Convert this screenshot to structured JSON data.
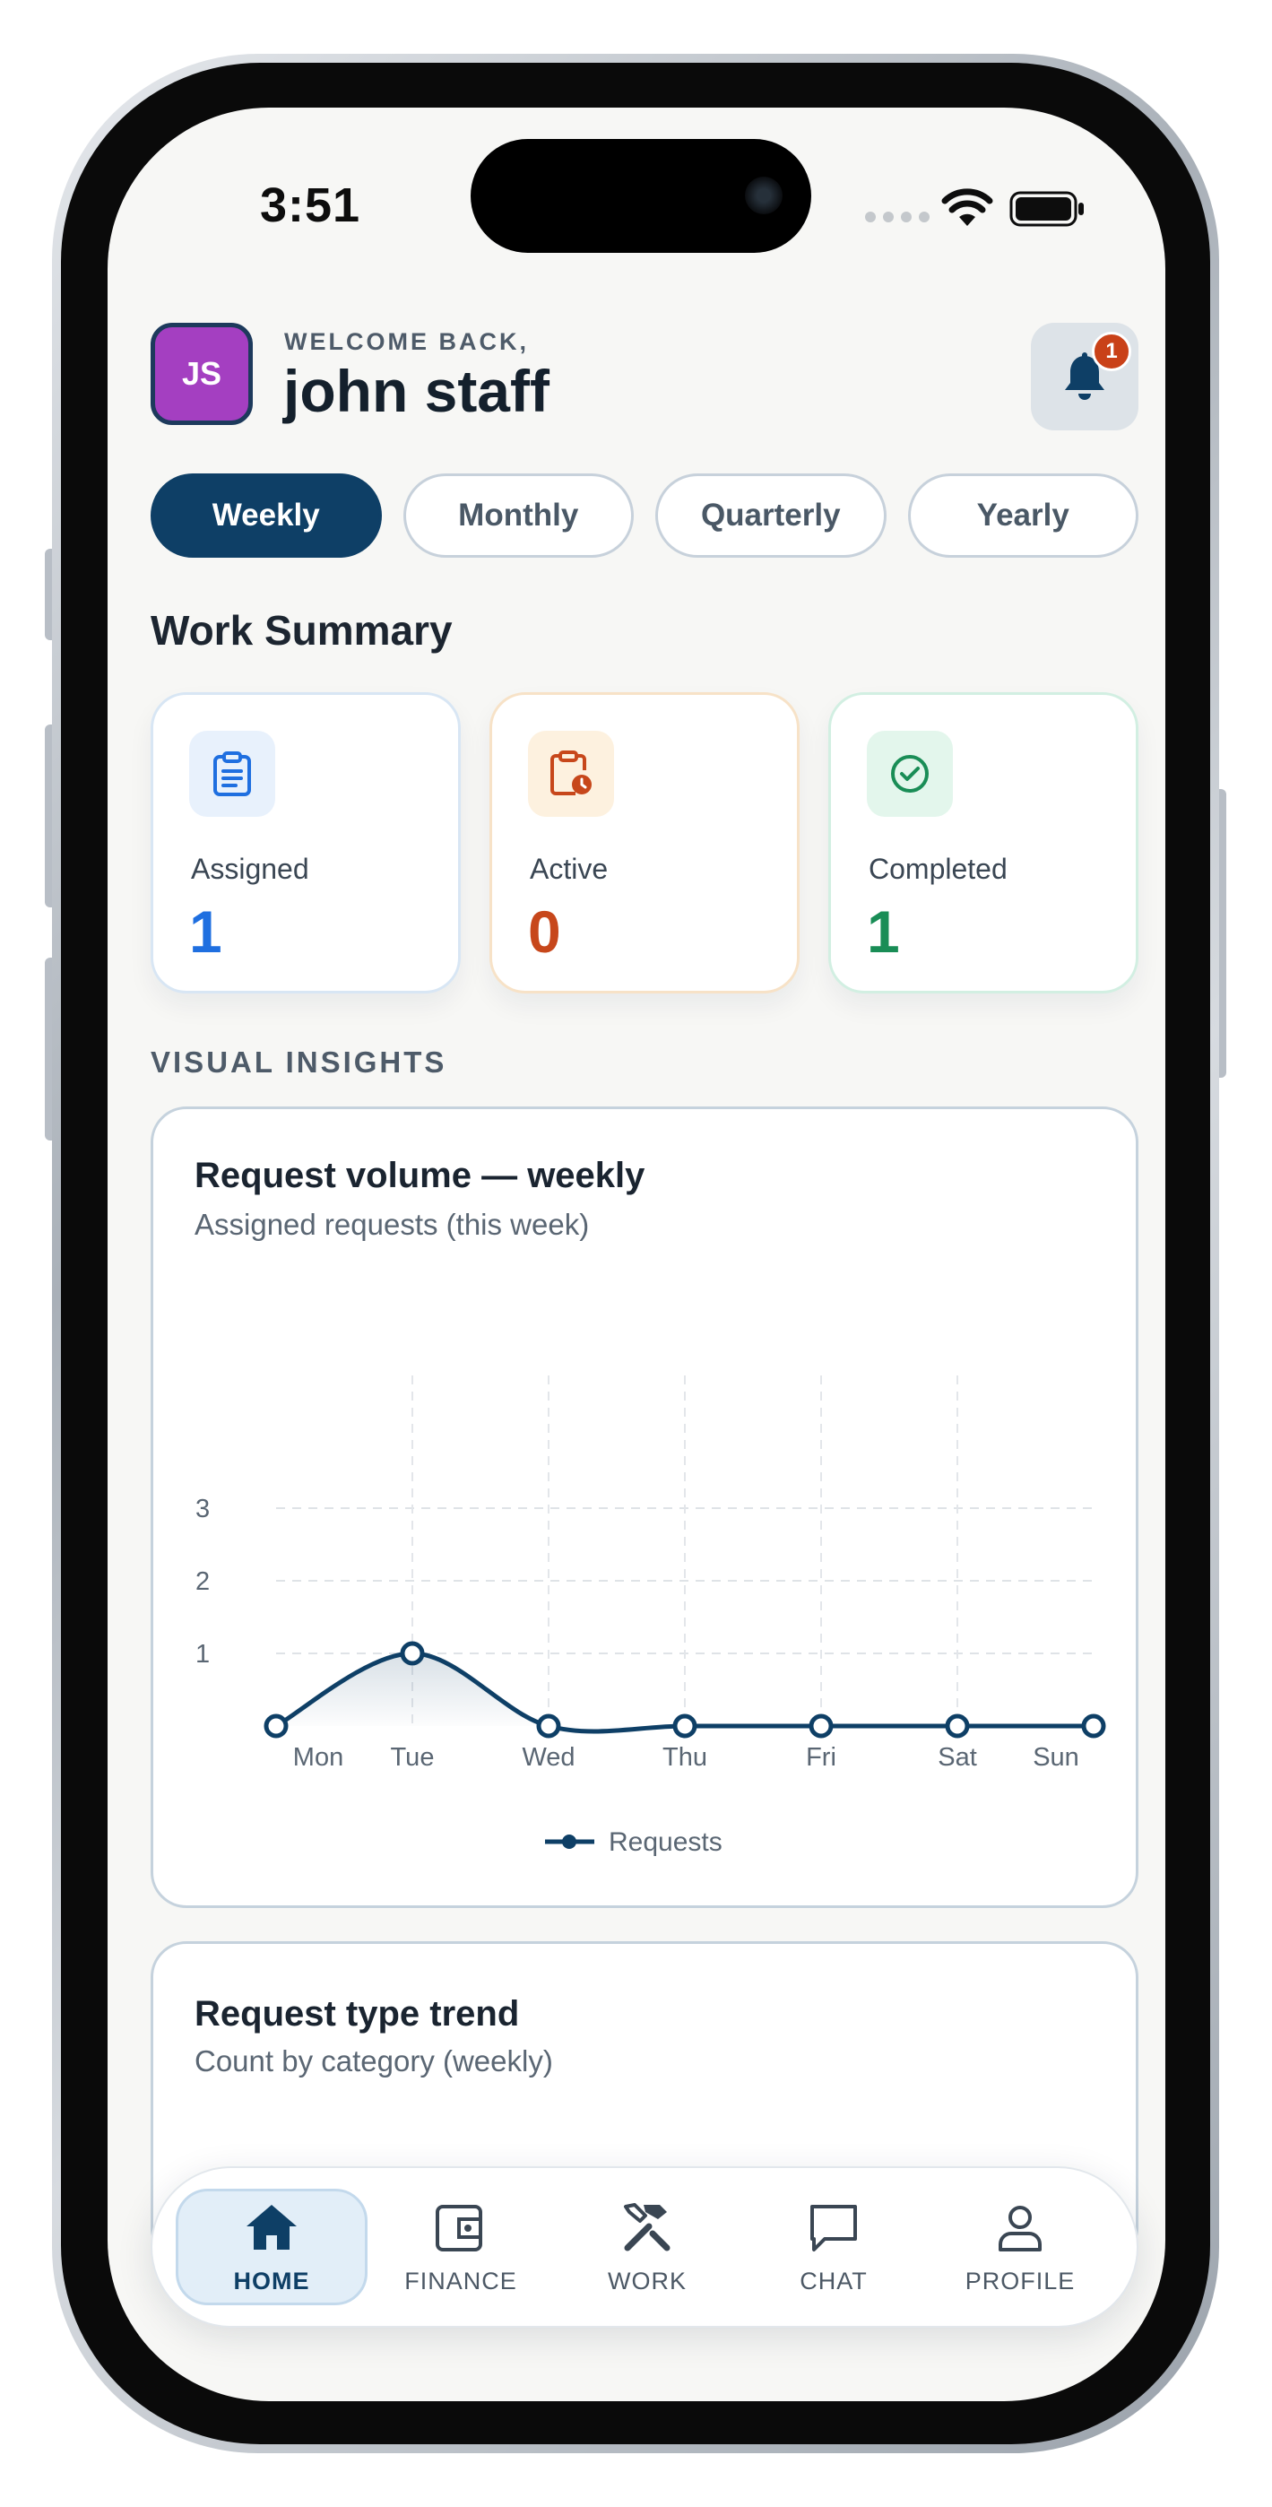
{
  "status_bar": {
    "time": "3:51"
  },
  "header": {
    "avatar_initials": "JS",
    "welcome": "WELCOME BACK,",
    "username": "john staff",
    "notification_count": "1"
  },
  "period_tabs": [
    {
      "label": "Weekly",
      "selected": true
    },
    {
      "label": "Monthly",
      "selected": false
    },
    {
      "label": "Quarterly",
      "selected": false
    },
    {
      "label": "Yearly",
      "selected": false
    }
  ],
  "work_summary": {
    "title": "Work Summary",
    "cards": [
      {
        "label": "Assigned",
        "value": "1",
        "icon": "clipboard-list-icon",
        "color": "#1f6fe0"
      },
      {
        "label": "Active",
        "value": "0",
        "icon": "clipboard-clock-icon",
        "color": "#c7471b"
      },
      {
        "label": "Completed",
        "value": "1",
        "icon": "check-circle-icon",
        "color": "#198d56"
      }
    ]
  },
  "insights": {
    "section_label": "VISUAL INSIGHTS",
    "volume_card": {
      "title": "Request volume — weekly",
      "subtitle": "Assigned requests (this week)"
    },
    "trend_card": {
      "title": "Request type trend",
      "subtitle": "Count by category (weekly)"
    }
  },
  "chart_data": {
    "type": "line",
    "categories": [
      "Mon",
      "Tue",
      "Wed",
      "Thu",
      "Fri",
      "Sat",
      "Sun"
    ],
    "series": [
      {
        "name": "Requests",
        "values": [
          0,
          1,
          0,
          0,
          0,
          0,
          0
        ],
        "color": "#0e3f66"
      }
    ],
    "y_ticks": [
      "1",
      "2",
      "3"
    ],
    "ylim": [
      0,
      3
    ],
    "grid": true,
    "legend": "bottom-center",
    "title": "Request volume — weekly",
    "subtitle": "Assigned requests (this week)"
  },
  "bottom_nav": [
    {
      "label": "HOME",
      "icon": "home-icon",
      "active": true
    },
    {
      "label": "FINANCE",
      "icon": "wallet-icon",
      "active": false
    },
    {
      "label": "WORK",
      "icon": "tools-icon",
      "active": false
    },
    {
      "label": "CHAT",
      "icon": "chat-bubble-icon",
      "active": false
    },
    {
      "label": "PROFILE",
      "icon": "user-icon",
      "active": false
    }
  ],
  "colors": {
    "primary": "#0e3f66",
    "avatar": "#a43fc1",
    "badge": "#c94118"
  }
}
